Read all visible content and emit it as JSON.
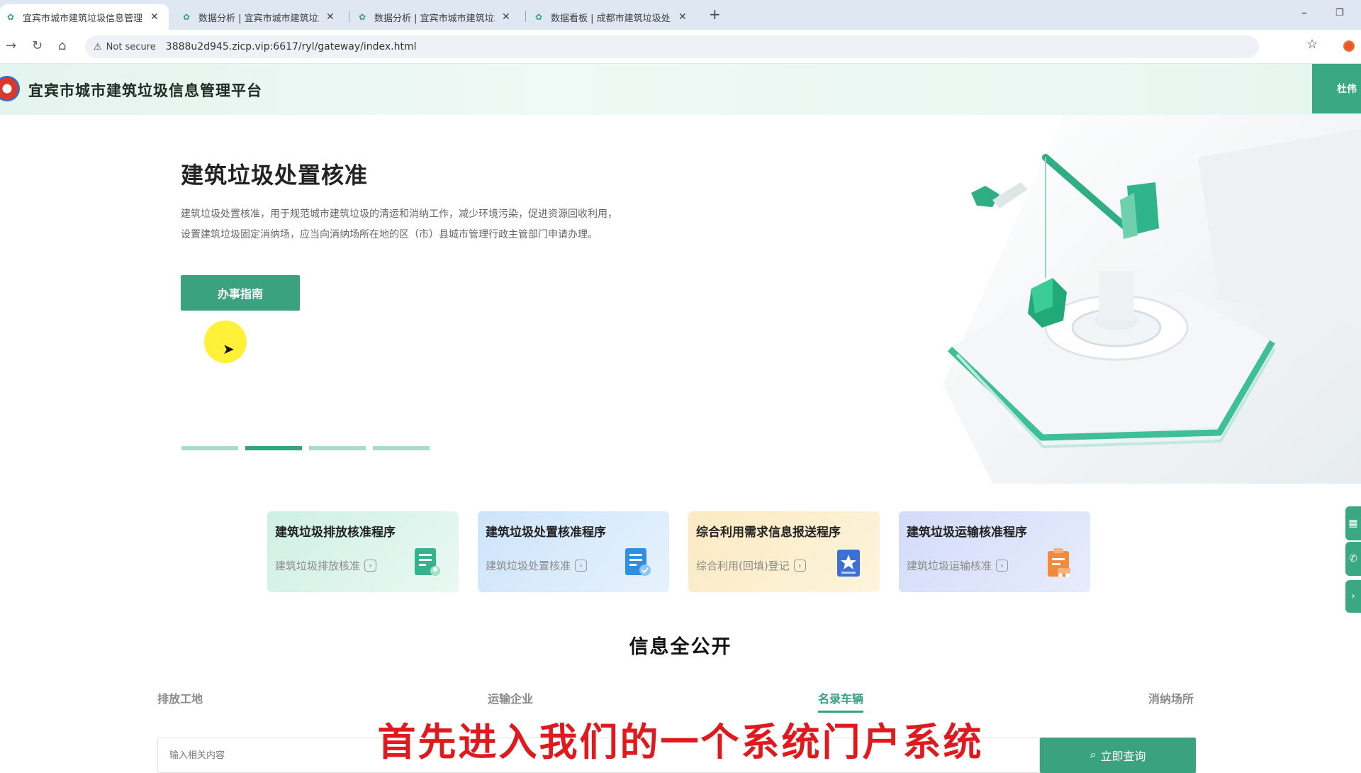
{
  "browser": {
    "tabs": [
      {
        "title": "宜宾市城市建筑垃圾信息管理平",
        "active": true
      },
      {
        "title": "数据分析 | 宜宾市城市建筑垃圾",
        "active": false
      },
      {
        "title": "数据分析 | 宜宾市城市建筑垃圾",
        "active": false
      },
      {
        "title": "数据看板 | 成都市建筑垃圾处置",
        "active": false
      }
    ],
    "security_label": "Not secure",
    "url": "3888u2d945.zicp.vip:6617/ryl/gateway/index.html"
  },
  "header": {
    "title": "宜宾市城市建筑垃圾信息管理平台",
    "user_label": "杜伟"
  },
  "hero": {
    "title": "建筑垃圾处置核准",
    "description": "建筑垃圾处置核准，用于规范城市建筑垃圾的清运和消纳工作，减少环境污染，促进资源回收利用，设置建筑垃圾固定消纳场，应当向消纳场所在地的区（市）县城市管理行政主管部门申请办理。",
    "button_label": "办事指南",
    "carousel": {
      "slides": 4,
      "active_index": 1
    }
  },
  "cards": [
    {
      "title": "建筑垃圾排放核准程序",
      "link": "建筑垃圾排放核准",
      "icon": "document-person-icon",
      "color": "#36b38a"
    },
    {
      "title": "建筑垃圾处置核准程序",
      "link": "建筑垃圾处置核准",
      "icon": "document-check-icon",
      "color": "#2f8fe0"
    },
    {
      "title": "综合利用需求信息报送程序",
      "link": "综合利用(回填)登记",
      "icon": "star-badge-icon",
      "color": "#3d6fd6"
    },
    {
      "title": "建筑垃圾运输核准程序",
      "link": "建筑垃圾运输核准",
      "icon": "truck-document-icon",
      "color": "#f08a3c"
    }
  ],
  "info": {
    "title": "信息全公开",
    "tabs": [
      "排放工地",
      "运输企业",
      "名录车辆",
      "消纳场所"
    ],
    "active_tab": 2,
    "search_placeholder": "输入相关内容",
    "search_button": "立即查询"
  },
  "subtitle": "首先进入我们的一个系统门户系统",
  "colors": {
    "accent": "#3aa27f",
    "subtitle": "#e0191e"
  }
}
